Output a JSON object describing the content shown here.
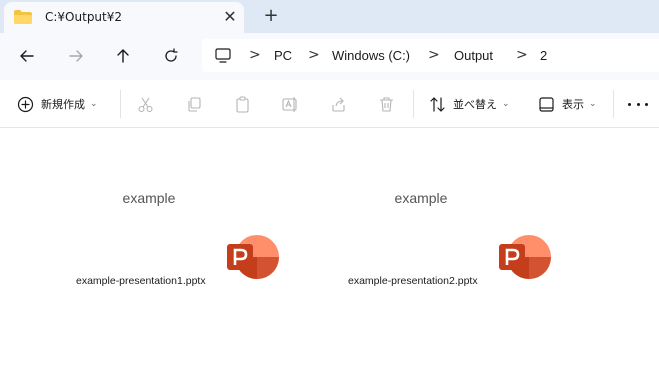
{
  "window": {
    "tab_title": "C:¥Output¥2",
    "tab_close": "✕",
    "new_tab": "+"
  },
  "nav": {
    "back": "back-arrow",
    "forward": "forward-arrow",
    "up": "up-arrow",
    "refresh": "refresh",
    "breadcrumb": [
      "PC",
      "Windows (C:)",
      "Output",
      "2"
    ],
    "separator": ">"
  },
  "commands": {
    "new_label": "新規作成",
    "sort_label": "並べ替え",
    "view_label": "表示",
    "chevron": "⌄"
  },
  "files": [
    {
      "thumb_text": "example",
      "name": "example-presentation1.pptx"
    },
    {
      "thumb_text": "example",
      "name": "example-presentation2.pptx"
    }
  ],
  "colors": {
    "tabbar_bg": "#dfe9f6",
    "nav_bg": "#f7f9fc",
    "ppt_orange": "#d35230",
    "ppt_light": "#ff8f6b",
    "folder_yellow": "#f5c342"
  }
}
